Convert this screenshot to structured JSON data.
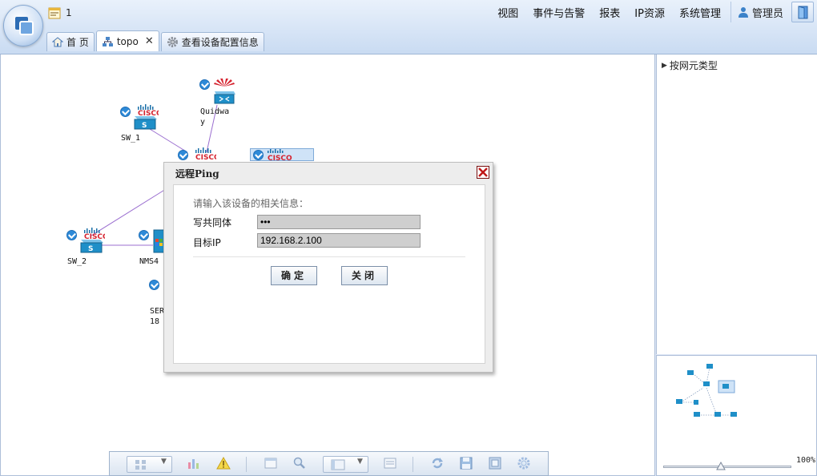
{
  "header": {
    "notice_count": "1",
    "menu": [
      "视图",
      "事件与告警",
      "报表",
      "IP资源",
      "系统管理"
    ],
    "user": "管理员"
  },
  "tabs": [
    {
      "label": "首 页",
      "icon": "home-icon"
    },
    {
      "label": "topo",
      "icon": "topology-icon",
      "active": true
    },
    {
      "label": "查看设备配置信息",
      "icon": "gear-icon"
    }
  ],
  "topology": {
    "nodes": {
      "quidway": "Quidwa\ny",
      "sw1": "SW_1",
      "sw2": "SW_2",
      "nms4": "NMS4",
      "serv": "SERV\n18"
    }
  },
  "dialog": {
    "title": "远程Ping",
    "hint": "请输入该设备的相关信息：",
    "community_label": "写共同体",
    "community_value": "•••",
    "target_label": "目标IP",
    "target_value": "192.168.2.100",
    "ok_label": "确定",
    "close_label": "关闭"
  },
  "tree": {
    "root_label": "按网元类型"
  },
  "overview": {
    "zoom_label": "100%",
    "zoom_level": 0.45
  },
  "colors": {
    "header_bg": "#c9dbf2",
    "cisco_blue": "#1f8fc8",
    "link_line": "#9b6fd0",
    "huawei_red": "#d5232f"
  }
}
